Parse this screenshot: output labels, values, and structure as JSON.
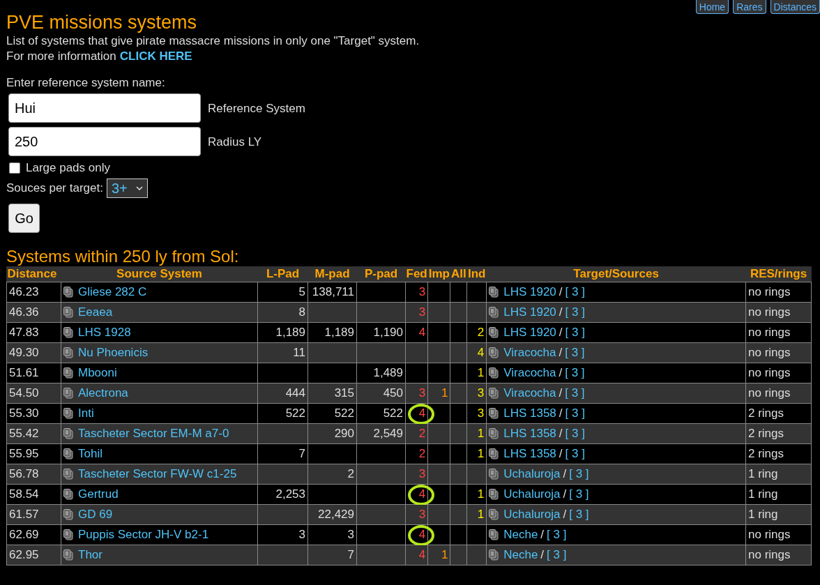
{
  "nav": [
    {
      "label": "Home"
    },
    {
      "label": "Rares"
    },
    {
      "label": "Distances"
    }
  ],
  "title": "PVE missions systems",
  "description": "List of systems that give pirate massacre missions in only one \"Target\" system.",
  "info": {
    "text": "For more information",
    "link": "CLICK HERE"
  },
  "form": {
    "prompt": "Enter reference system name:",
    "reference": {
      "value": "Hui",
      "label": "Reference System"
    },
    "radius": {
      "value": "250",
      "label": "Radius LY"
    },
    "large_pads": {
      "label": "Large pads only",
      "checked": false
    },
    "sources": {
      "label": "Souces per target:",
      "value": "3+"
    },
    "go": "Go"
  },
  "results_heading": "Systems within 250 ly from Sol:",
  "table": {
    "columns": [
      "Distance",
      "Source System",
      "L-Pad",
      "M-pad",
      "P-pad",
      "Fed",
      "Imp",
      "All",
      "Ind",
      "Target/Sources",
      "RES/rings"
    ],
    "rows": [
      {
        "distance": "46.23",
        "source": "Gliese 282 C",
        "lpad": "5",
        "mpad": "138,711",
        "ppad": "",
        "fed": "3",
        "imp": "",
        "all": "",
        "ind": "",
        "target": "LHS 1920",
        "separator": "/",
        "count": "[ 3 ]",
        "res": "no rings",
        "circled": false
      },
      {
        "distance": "46.36",
        "source": "Eeaea",
        "lpad": "8",
        "mpad": "",
        "ppad": "",
        "fed": "3",
        "imp": "",
        "all": "",
        "ind": "",
        "target": "LHS 1920",
        "separator": "/",
        "count": "[ 3 ]",
        "res": "no rings",
        "circled": false
      },
      {
        "distance": "47.83",
        "source": "LHS 1928",
        "lpad": "1,189",
        "mpad": "1,189",
        "ppad": "1,190",
        "fed": "4",
        "imp": "",
        "all": "",
        "ind": "2",
        "target": "LHS 1920",
        "separator": "/",
        "count": "[ 3 ]",
        "res": "no rings",
        "circled": false
      },
      {
        "distance": "49.30",
        "source": "Nu Phoenicis",
        "lpad": "11",
        "mpad": "",
        "ppad": "",
        "fed": "",
        "imp": "",
        "all": "",
        "ind": "4",
        "target": "Viracocha",
        "separator": "/",
        "count": "[ 3 ]",
        "res": "no rings",
        "circled": false
      },
      {
        "distance": "51.61",
        "source": "Mbooni",
        "lpad": "",
        "mpad": "",
        "ppad": "1,489",
        "fed": "",
        "imp": "",
        "all": "",
        "ind": "1",
        "target": "Viracocha",
        "separator": "/",
        "count": "[ 3 ]",
        "res": "no rings",
        "circled": false
      },
      {
        "distance": "54.50",
        "source": "Alectrona",
        "lpad": "444",
        "mpad": "315",
        "ppad": "450",
        "fed": "3",
        "imp": "1",
        "all": "",
        "ind": "3",
        "target": "Viracocha",
        "separator": "/",
        "count": "[ 3 ]",
        "res": "no rings",
        "circled": false
      },
      {
        "distance": "55.30",
        "source": "Inti",
        "lpad": "522",
        "mpad": "522",
        "ppad": "522",
        "fed": "4",
        "imp": "",
        "all": "",
        "ind": "3",
        "target": "LHS 1358",
        "separator": "/",
        "count": "[ 3 ]",
        "res": "2 rings",
        "circled": true
      },
      {
        "distance": "55.42",
        "source": "Tascheter Sector EM-M a7-0",
        "lpad": "",
        "mpad": "290",
        "ppad": "2,549",
        "fed": "2",
        "imp": "",
        "all": "",
        "ind": "1",
        "target": "LHS 1358",
        "separator": "/",
        "count": "[ 3 ]",
        "res": "2 rings",
        "circled": false
      },
      {
        "distance": "55.95",
        "source": "Tohil",
        "lpad": "7",
        "mpad": "",
        "ppad": "",
        "fed": "2",
        "imp": "",
        "all": "",
        "ind": "1",
        "target": "LHS 1358",
        "separator": "/",
        "count": "[ 3 ]",
        "res": "2 rings",
        "circled": false
      },
      {
        "distance": "56.78",
        "source": "Tascheter Sector FW-W c1-25",
        "lpad": "",
        "mpad": "2",
        "ppad": "",
        "fed": "3",
        "imp": "",
        "all": "",
        "ind": "",
        "target": "Uchaluroja",
        "separator": "/",
        "count": "[ 3 ]",
        "res": "1 ring",
        "circled": false
      },
      {
        "distance": "58.54",
        "source": "Gertrud",
        "lpad": "2,253",
        "mpad": "",
        "ppad": "",
        "fed": "4",
        "imp": "",
        "all": "",
        "ind": "1",
        "target": "Uchaluroja",
        "separator": "/",
        "count": "[ 3 ]",
        "res": "1 ring",
        "circled": true
      },
      {
        "distance": "61.57",
        "source": "GD 69",
        "lpad": "",
        "mpad": "22,429",
        "ppad": "",
        "fed": "3",
        "imp": "",
        "all": "",
        "ind": "1",
        "target": "Uchaluroja",
        "separator": "/",
        "count": "[ 3 ]",
        "res": "1 ring",
        "circled": false
      },
      {
        "distance": "62.69",
        "source": "Puppis Sector JH-V b2-1",
        "lpad": "3",
        "mpad": "3",
        "ppad": "",
        "fed": "4",
        "imp": "",
        "all": "",
        "ind": "",
        "target": "Neche",
        "separator": "/",
        "count": "[ 3 ]",
        "res": "no rings",
        "circled": true
      },
      {
        "distance": "62.95",
        "source": "Thor",
        "lpad": "",
        "mpad": "7",
        "ppad": "",
        "fed": "4",
        "imp": "1",
        "all": "",
        "ind": "",
        "target": "Neche",
        "separator": "/",
        "count": "[ 3 ]",
        "res": "no rings",
        "circled": false
      }
    ]
  }
}
